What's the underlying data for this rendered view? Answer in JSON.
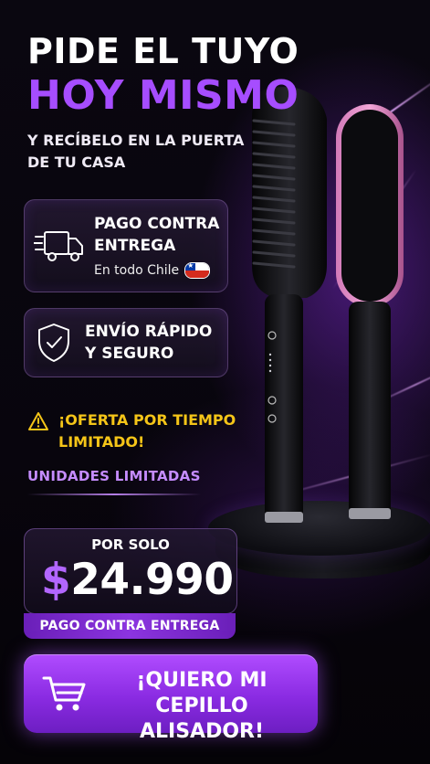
{
  "headline": {
    "line1": "PIDE EL TUYO",
    "line2": "HOY MISMO",
    "subline": "Y RECÍBELO EN LA PUERTA DE TU CASA"
  },
  "features": {
    "payment": {
      "title_line1": "PAGO CONTRA",
      "title_line2": "ENTREGA",
      "detail": "En todo Chile",
      "icon": "delivery-truck-icon"
    },
    "shipping": {
      "title_line1": "ENVÍO RÁPIDO",
      "title_line2": "Y SEGURO",
      "icon": "shield-check-icon"
    }
  },
  "offer": {
    "warning_line1": "¡OFERTA POR TIEMPO",
    "warning_line2": "LIMITADO!",
    "icon": "warning-icon"
  },
  "units_text": "UNIDADES LIMITADAS",
  "price": {
    "prefix": "POR SOLO",
    "currency": "$",
    "amount": "24.990",
    "payment_method": "PAGO CONTRA ENTREGA"
  },
  "cta": {
    "line1": "¡QUIERO MI",
    "line2": "CEPILLO ALISADOR!",
    "icon": "shopping-cart-icon"
  },
  "colors": {
    "accent_purple": "#a64dff",
    "warning_yellow": "#f5c518",
    "cta_purple": "#8a2be2",
    "background": "#060409"
  }
}
